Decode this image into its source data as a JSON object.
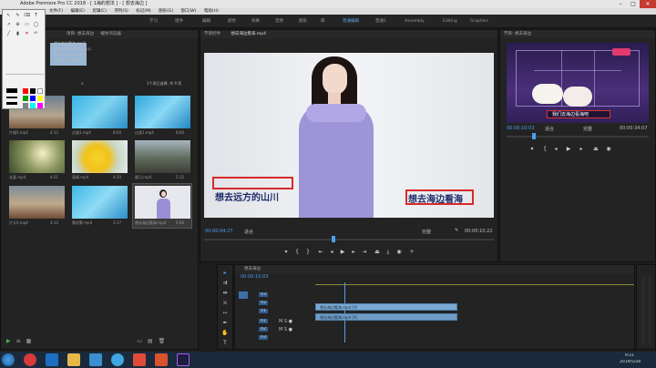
{
  "window": {
    "title": "Adobe Premiere Pro CC 2018 - [ 1海的想法 ] - [ 想去海边 ]",
    "icons": [
      "minimize-icon",
      "maximize-icon",
      "close-icon"
    ]
  },
  "menubar": [
    "文件(F)",
    "编辑(E)",
    "剪辑(C)",
    "序列(S)",
    "标记(M)",
    "图形(G)",
    "窗口(W)",
    "帮助(H)"
  ],
  "workspaces": {
    "items": [
      "学习",
      "组件",
      "编辑",
      "颜色",
      "效果",
      "音频",
      "图形",
      "库",
      "普通1",
      "普通编辑",
      "Assembly",
      "Editing",
      "Graphics"
    ],
    "active": "普通编辑"
  },
  "project": {
    "tabs": [
      "项目: 想去海边",
      "媒体浏览器"
    ],
    "file_info": [
      "想去海边看海.mp4",
      "视频, 1920 x 1080 (1.0)",
      "00:00:05:06, 25.00p",
      "48000 Hz - 立体声"
    ],
    "count": "1个项已选择, 共 9 项",
    "items": [
      {
        "name": "片尾0.mp4",
        "duration": "4:12"
      },
      {
        "name": "过渡1.mp4",
        "duration": "8:00"
      },
      {
        "name": "过渡1.mp4",
        "duration": "8:00"
      },
      {
        "name": "长夏.mp4",
        "duration": "4:21"
      },
      {
        "name": "表情.mp4",
        "duration": "4:20"
      },
      {
        "name": "夏日.mp4",
        "duration": "5:12"
      },
      {
        "name": "片头0.mp4",
        "duration": "4:12"
      },
      {
        "name": "素材素.mp4",
        "duration": "3:17"
      },
      {
        "name": "想去海边看海.mp4",
        "duration": "5:06"
      }
    ]
  },
  "program": {
    "tabs": [
      "节目控件",
      "想去海边看海.mp4"
    ],
    "subtitle_left": "想去远方的山川",
    "subtitle_right": "想去海边看海",
    "timecode_current": "00:00:04:27",
    "fit": "适合",
    "quality": "完整",
    "timecode_total": "00:00:10:22"
  },
  "source": {
    "tab": "节目: 想去海边",
    "timecode_current": "00:00:10:03",
    "fit": "适合",
    "quality": "完整",
    "timecode_total": "00:00:34:07",
    "caption": "我们去海边看海吧"
  },
  "timeline": {
    "tab": "想去海边",
    "timecode": "00:00:10:03",
    "tracks": [
      "V3",
      "V2",
      "V1",
      "A1",
      "A2",
      "A3"
    ],
    "clips": [
      "想去海边看海.mp4 [V]",
      "想去海边看海.mp4 [A]"
    ]
  },
  "taskbar": {
    "icons": [
      "start-icon",
      "browser-icon",
      "media-player-icon",
      "folder-icon",
      "monitor-icon",
      "phone-icon",
      "app-icon",
      "office-icon",
      "settings-icon",
      "premiere-icon"
    ],
    "time": "9:21",
    "date": "2019/5/28"
  },
  "tool_palette": {
    "icons": [
      "pointer-icon",
      "pen-icon",
      "eraser-icon",
      "text-icon",
      "arrow-icon",
      "zoom-icon"
    ],
    "colors": [
      "#ff0000",
      "#000000",
      "#ff0000",
      "#00a000",
      "#ffffff",
      "#0000ff",
      "#ffff00",
      "#808080",
      "#00ffff",
      "#ff00ff",
      "#800000",
      "#008000"
    ]
  }
}
